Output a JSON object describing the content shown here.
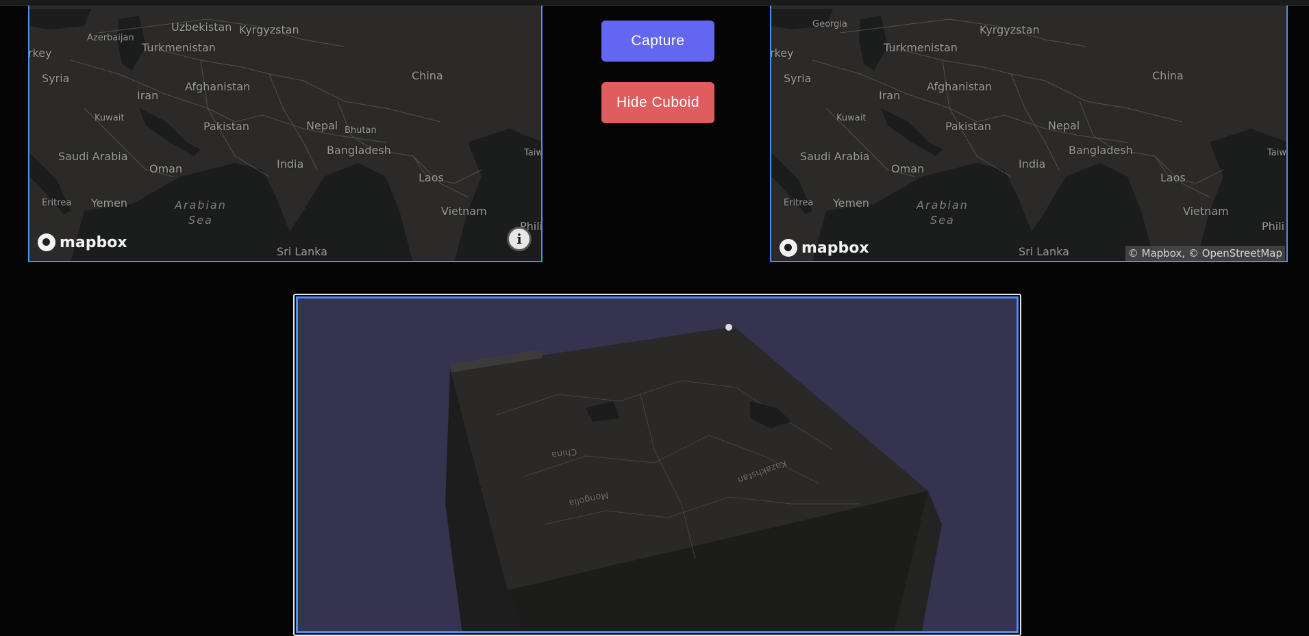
{
  "buttons": {
    "capture_label": "Capture",
    "hide_cuboid_label": "Hide Cuboid"
  },
  "left_map": {
    "labels": {
      "turkey": "rkey",
      "azerbaijan": "Azerbaijan",
      "uzbekistan": "Uzbekistan",
      "kyrgyzstan": "Kyrgyzstan",
      "turkmenistan": "Turkmenistan",
      "syria": "Syria",
      "iran": "Iran",
      "afghanistan": "Afghanistan",
      "china": "China",
      "kuwait": "Kuwait",
      "pakistan": "Pakistan",
      "nepal": "Nepal",
      "bhutan": "Bhutan",
      "saudi_arabia": "Saudi Arabia",
      "oman": "Oman",
      "india": "India",
      "bangladesh": "Bangladesh",
      "taiwan": "Taiw",
      "laos": "Laos",
      "eritrea": "Eritrea",
      "yemen": "Yemen",
      "arabian_sea_1": "Arabian",
      "arabian_sea_2": "Sea",
      "vietnam": "Vietnam",
      "philippines": "Phili",
      "sri_lanka": "Sri Lanka"
    },
    "logo_text": "mapbox",
    "info_icon": "i"
  },
  "right_map": {
    "labels": {
      "georgia": "Georgia",
      "kyrgyzstan": "Kyrgyzstan",
      "turkey": "rkey",
      "turkmenistan": "Turkmenistan",
      "syria": "Syria",
      "china": "China",
      "afghanistan": "Afghanistan",
      "iran": "Iran",
      "kuwait": "Kuwait",
      "pakistan": "Pakistan",
      "nepal": "Nepal",
      "saudi_arabia": "Saudi Arabia",
      "bangladesh": "Bangladesh",
      "taiwan": "Taiw",
      "oman": "Oman",
      "india": "India",
      "laos": "Laos",
      "eritrea": "Eritrea",
      "yemen": "Yemen",
      "arabian_sea_1": "Arabian",
      "arabian_sea_2": "Sea",
      "vietnam": "Vietnam",
      "philippines": "Phili",
      "sri_lanka": "Sri Lanka"
    },
    "logo_text": "mapbox",
    "attribution": "© Mapbox, © OpenStreetMap"
  },
  "cuboid_view": {
    "labels": {
      "china": "China",
      "mongolia": "Mongolia",
      "kazakhstan": "Kazakhstan"
    },
    "colors": {
      "background": "#353350",
      "top_face": "#2a2928",
      "side_face": "#1c1c1b",
      "front_face": "#232322"
    }
  },
  "colors": {
    "page_background": "#050505",
    "panel_border": "#4f8cf5",
    "capture_button": "#6366f1",
    "hide_button": "#e05d5f",
    "map_land": "#2b2a29",
    "map_water": "#1b1c1c"
  }
}
